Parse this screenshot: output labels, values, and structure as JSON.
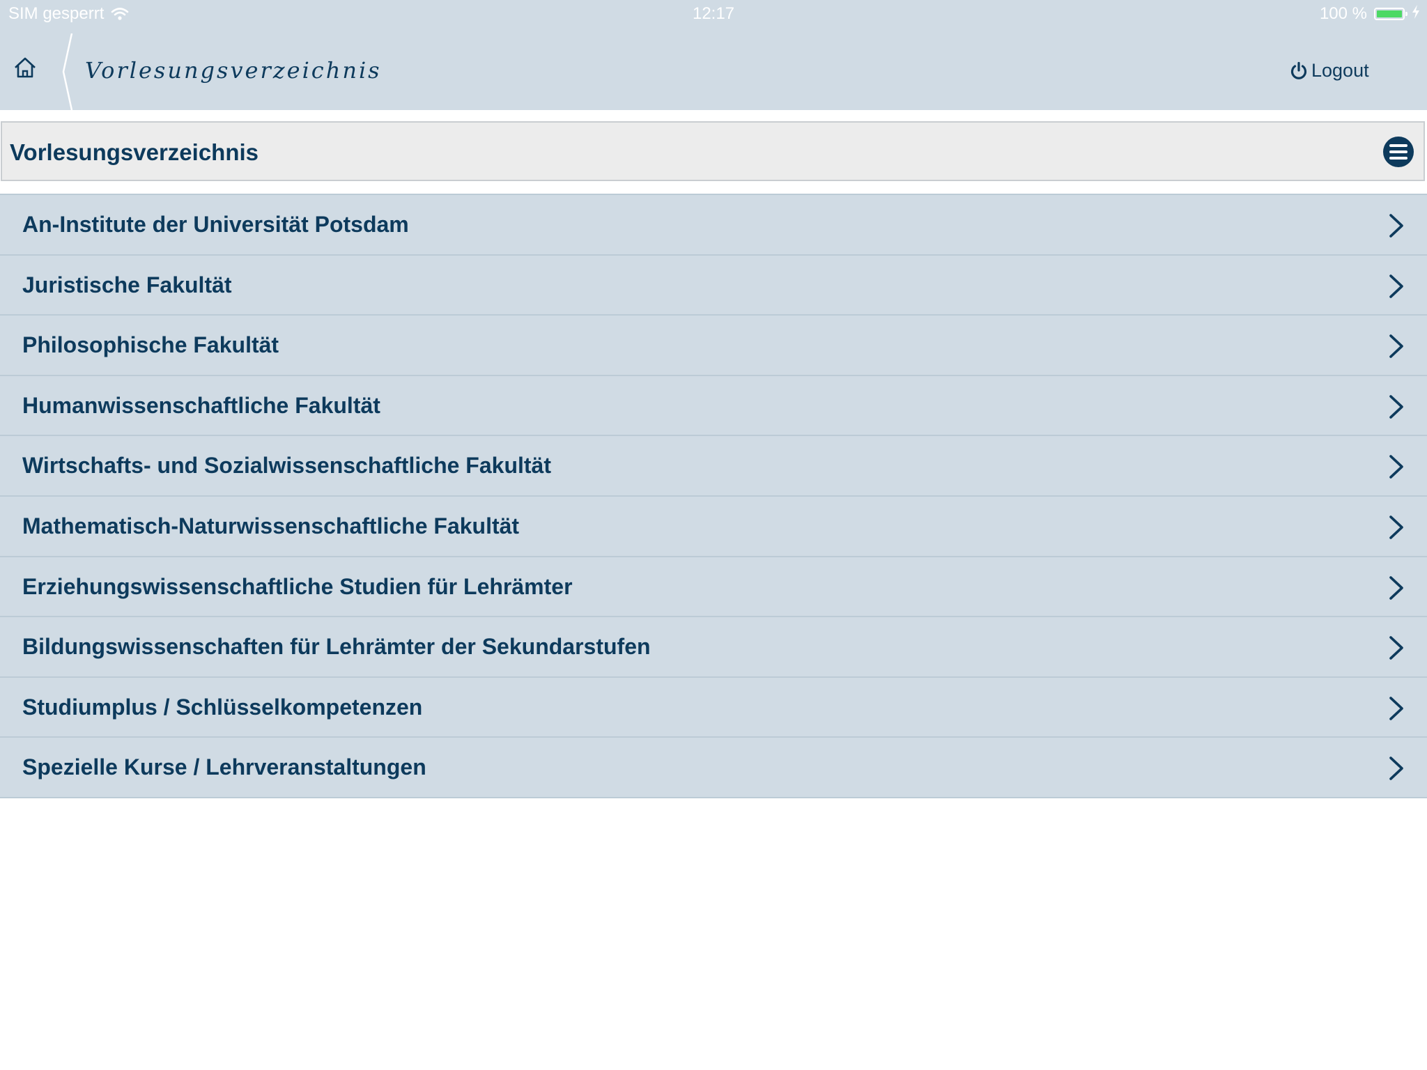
{
  "status_bar": {
    "carrier": "SIM gesperrt",
    "time": "12:17",
    "battery": "100 %",
    "battery_level": 1.0,
    "battery_color": "#4cd964"
  },
  "nav": {
    "title": "Vorlesungsverzeichnis",
    "logout_label": "Logout"
  },
  "section": {
    "title": "Vorlesungsverzeichnis"
  },
  "items": [
    {
      "label": "An-Institute der Universität Potsdam"
    },
    {
      "label": "Juristische Fakultät"
    },
    {
      "label": "Philosophische Fakultät"
    },
    {
      "label": "Humanwissenschaftliche Fakultät"
    },
    {
      "label": "Wirtschafts- und Sozialwissenschaftliche Fakultät"
    },
    {
      "label": "Mathematisch-Naturwissenschaftliche Fakultät"
    },
    {
      "label": "Erziehungswissenschaftliche Studien für Lehrämter"
    },
    {
      "label": "Bildungswissenschaften für Lehrämter der Sekundarstufen"
    },
    {
      "label": "Studiumplus / Schlüsselkompetenzen"
    },
    {
      "label": "Spezielle Kurse / Lehrveranstaltungen"
    }
  ],
  "icons": {
    "home": "home-icon",
    "logout": "power-icon",
    "menu": "hamburger-menu-icon",
    "chevron": "chevron-right-icon",
    "wifi": "wifi-icon",
    "battery": "battery-icon",
    "charging": "charging-bolt-icon"
  },
  "colors": {
    "brand_dark": "#0d3a5c",
    "nav_bg": "#d0dbe4",
    "header_bg": "#ececec"
  }
}
